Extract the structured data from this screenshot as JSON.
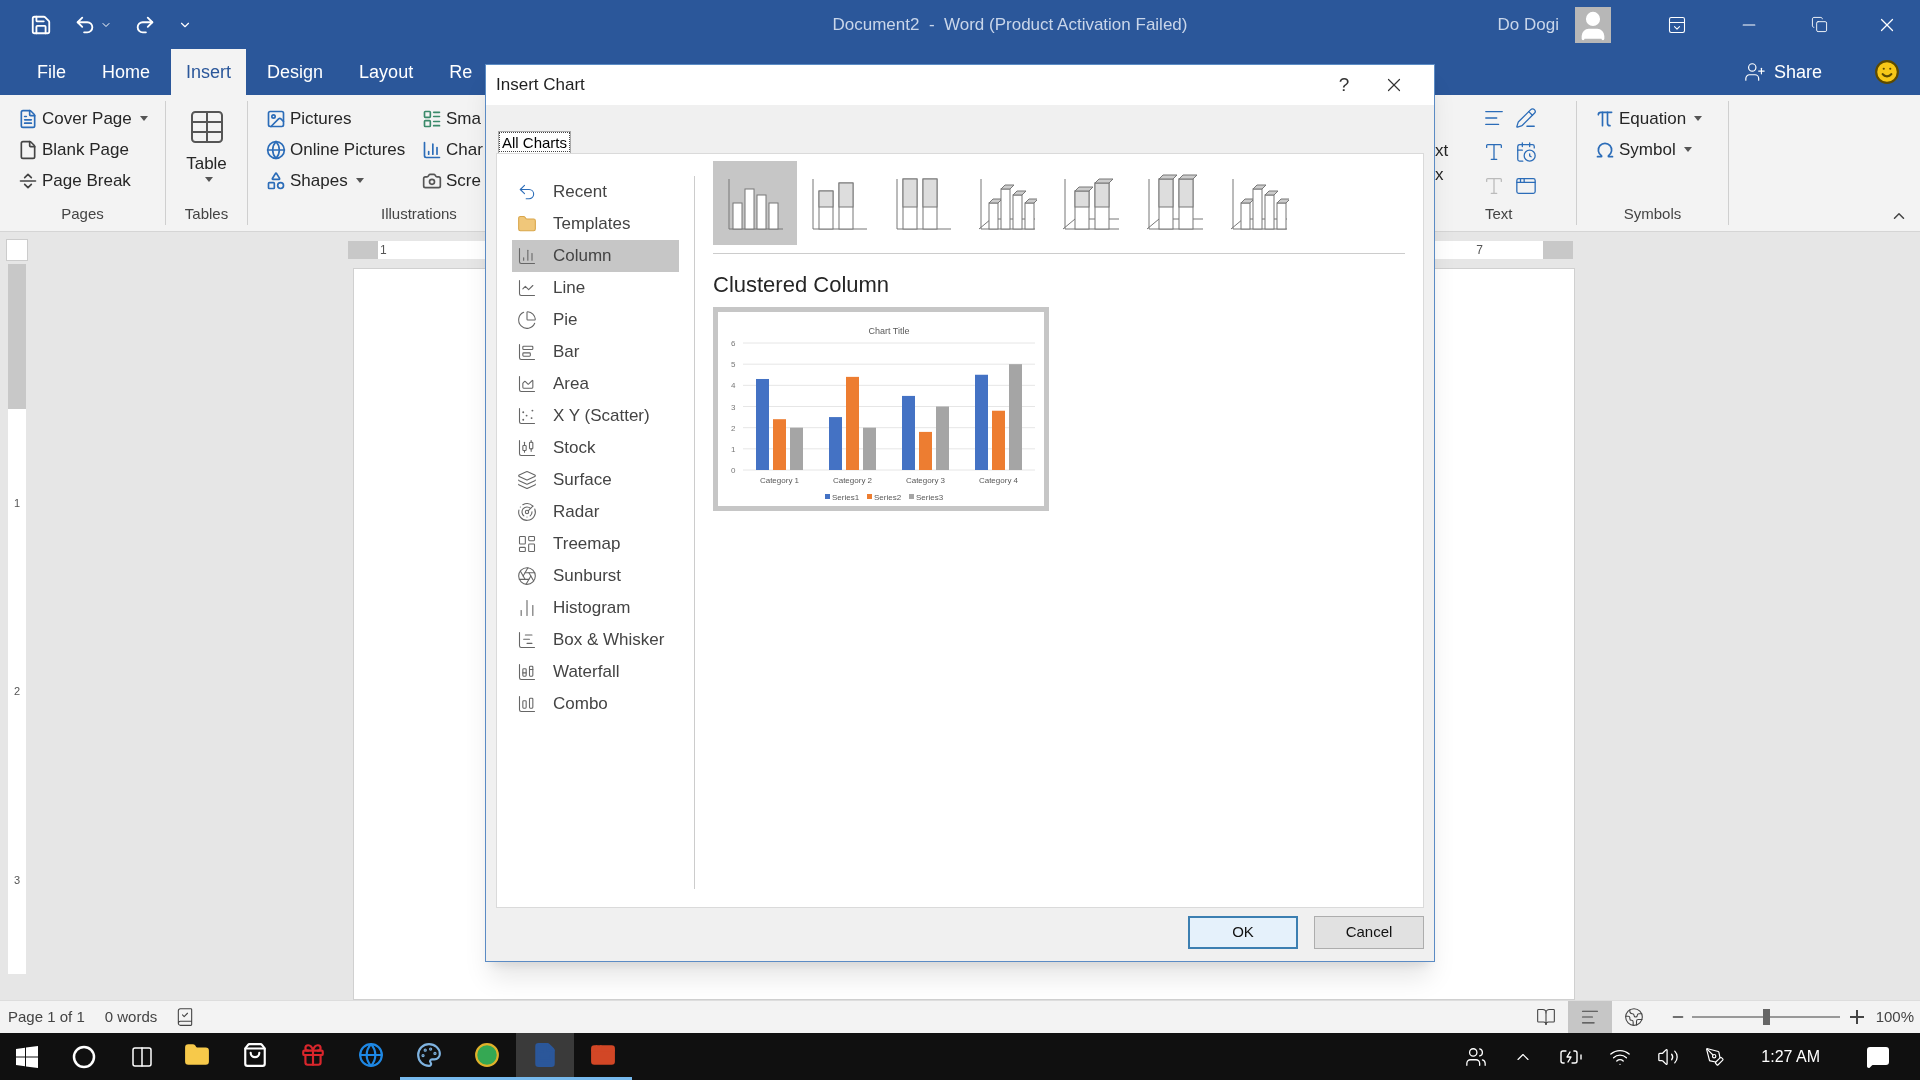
{
  "window": {
    "title": "Document2  -  Word (Product Activation Failed)",
    "user": "Do Dogi"
  },
  "ribbon_tabs": [
    {
      "label": "File",
      "selected": false
    },
    {
      "label": "Home",
      "selected": false
    },
    {
      "label": "Insert",
      "selected": true
    },
    {
      "label": "Design",
      "selected": false
    },
    {
      "label": "Layout",
      "selected": false
    },
    {
      "label": "Re",
      "selected": false
    }
  ],
  "share": "Share",
  "pages": {
    "label": "Pages",
    "items": [
      {
        "label": "Cover Page",
        "dropdown": true
      },
      {
        "label": "Blank Page",
        "dropdown": false
      },
      {
        "label": "Page Break",
        "dropdown": false
      }
    ]
  },
  "tables": {
    "label": "Tables",
    "button": "Table"
  },
  "illustrations": {
    "label": "Illustrations",
    "items": [
      {
        "label": "Pictures",
        "dropdown": false
      },
      {
        "label": "Online Pictures",
        "dropdown": false
      },
      {
        "label": "Shapes",
        "dropdown": true
      }
    ],
    "cut_items": [
      "Sma",
      "Char",
      "Scre"
    ]
  },
  "text_group": {
    "label": "Text",
    "cut_lines": [
      "xt",
      "x"
    ]
  },
  "symbols": {
    "label": "Symbols",
    "items": [
      {
        "label": "Equation",
        "dropdown": true
      },
      {
        "label": "Symbol",
        "dropdown": true
      }
    ]
  },
  "ruler": {
    "numbers": [
      "1",
      "7"
    ]
  },
  "vertical_ruler": [
    "1",
    "2",
    "3"
  ],
  "dialog": {
    "title": "Insert Chart",
    "help": "?",
    "tabs": [
      {
        "label": "All Charts",
        "selected": true
      }
    ],
    "chart_types": [
      {
        "label": "Recent",
        "selected": false
      },
      {
        "label": "Templates",
        "selected": false
      },
      {
        "label": "Column",
        "selected": true
      },
      {
        "label": "Line",
        "selected": false
      },
      {
        "label": "Pie",
        "selected": false
      },
      {
        "label": "Bar",
        "selected": false
      },
      {
        "label": "Area",
        "selected": false
      },
      {
        "label": "X Y (Scatter)",
        "selected": false
      },
      {
        "label": "Stock",
        "selected": false
      },
      {
        "label": "Surface",
        "selected": false
      },
      {
        "label": "Radar",
        "selected": false
      },
      {
        "label": "Treemap",
        "selected": false
      },
      {
        "label": "Sunburst",
        "selected": false
      },
      {
        "label": "Histogram",
        "selected": false
      },
      {
        "label": "Box & Whisker",
        "selected": false
      },
      {
        "label": "Waterfall",
        "selected": false
      },
      {
        "label": "Combo",
        "selected": false
      }
    ],
    "subtypes": [
      {
        "selected": true
      },
      {
        "selected": false
      },
      {
        "selected": false
      },
      {
        "selected": false
      },
      {
        "selected": false
      },
      {
        "selected": false
      },
      {
        "selected": false
      }
    ],
    "subtype_title": "Clustered Column",
    "preview": {
      "chart_data": {
        "type": "bar",
        "title": "Chart Title",
        "categories": [
          "Category 1",
          "Category 2",
          "Category 3",
          "Category 4"
        ],
        "series": [
          {
            "name": "Series1",
            "color": "#4472c4",
            "values": [
              4.3,
              2.5,
              3.5,
              4.5
            ]
          },
          {
            "name": "Series2",
            "color": "#ed7d31",
            "values": [
              2.4,
              4.4,
              1.8,
              2.8
            ]
          },
          {
            "name": "Series3",
            "color": "#a5a5a5",
            "values": [
              2,
              2,
              3,
              5
            ]
          }
        ],
        "ylim": [
          0,
          6
        ],
        "yticks": [
          {
            "value": 0,
            "label": "0"
          },
          {
            "value": 1,
            "label": "1"
          },
          {
            "value": 2,
            "label": "2"
          },
          {
            "value": 3,
            "label": "3"
          },
          {
            "value": 4,
            "label": "4"
          },
          {
            "value": 5,
            "label": "5"
          },
          {
            "value": 6,
            "label": "6"
          }
        ],
        "grid": true,
        "legend": true
      }
    },
    "buttons": [
      {
        "label": "OK",
        "default": true
      },
      {
        "label": "Cancel",
        "default": false
      }
    ]
  },
  "status_bar": {
    "page": "Page 1 of 1",
    "words": "0 words",
    "views": [
      {
        "selected": false
      },
      {
        "selected": true
      },
      {
        "selected": false
      }
    ],
    "zoom": {
      "level": 0.5
    },
    "zoom_reading": "100%"
  },
  "taskbar": {
    "apps": [
      {
        "running": false,
        "active": false
      },
      {
        "running": false,
        "active": false
      },
      {
        "running": false,
        "active": false
      },
      {
        "running": false,
        "active": false
      },
      {
        "running": true,
        "active": false
      },
      {
        "running": true,
        "active": false
      },
      {
        "running": true,
        "active": true
      },
      {
        "running": true,
        "active": false
      }
    ],
    "time": "1:27 AM"
  }
}
